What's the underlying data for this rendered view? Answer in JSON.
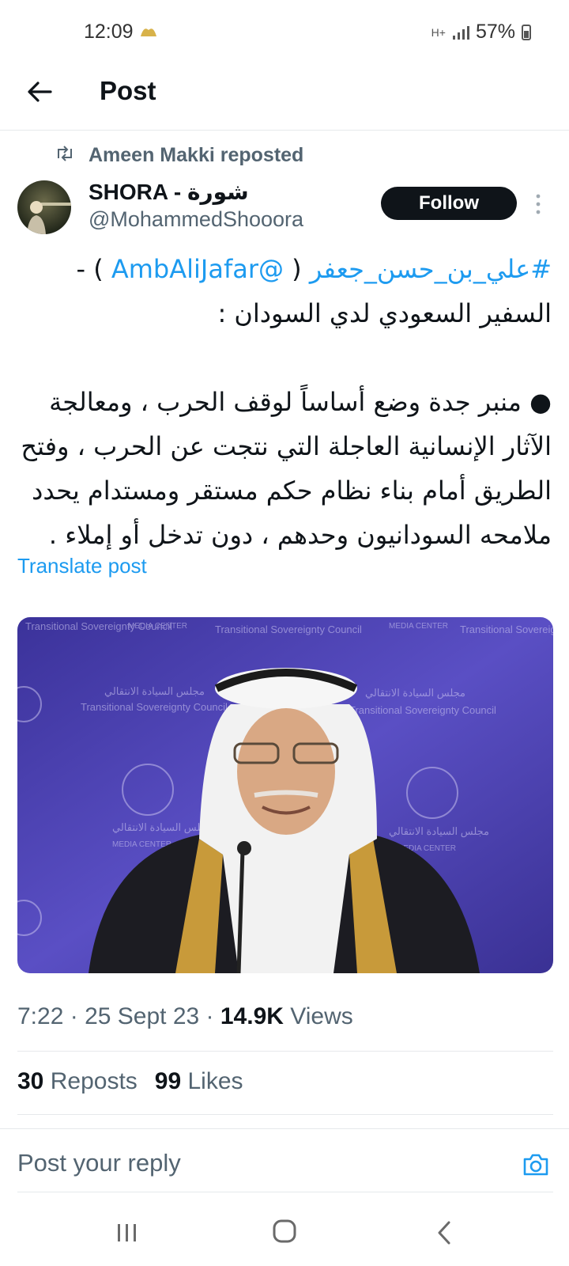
{
  "status_bar": {
    "time": "12:09",
    "battery": "57%",
    "network": "H+"
  },
  "header": {
    "title": "Post"
  },
  "repost": {
    "text": "Ameen Makki reposted"
  },
  "author": {
    "name": "SHORA - شورة",
    "handle": "@MohammedShooora"
  },
  "follow_label": "Follow",
  "tweet": {
    "hashtag": "#علي_بن_حسن_جعفر",
    "open_paren": " ( ",
    "mention": "@AmbAliJafar",
    "close": " ) -",
    "line2": "السفير السعودي لدي السودان :",
    "paragraph": "● منبر جدة وضع أساساً لوقف الحرب ، ومعالجة الآثار الإنسانية العاجلة التي نتجت عن الحرب ، وفتح الطريق أمام بناء نظام حكم مستقر ومستدام يحدد ملامحه السودانيون وحدهم ، دون تدخل أو إملاء ."
  },
  "translate_label": "Translate post",
  "media": {
    "backdrop_text_1": "Transitional Sovereignty Council",
    "backdrop_text_2": "MEDIA CENTER",
    "backdrop_arabic": "مجلس السيادة الانتقالي"
  },
  "meta": {
    "time": "7:22",
    "date": "25 Sept 23",
    "views_count": "14.9K",
    "views_label": "Views",
    "sep": " · "
  },
  "stats": {
    "reposts_count": "30",
    "reposts_label": "Reposts",
    "likes_count": "99",
    "likes_label": "Likes"
  },
  "reply": {
    "placeholder": "Post your reply"
  },
  "colors": {
    "link": "#1d9bf0",
    "follow_bg": "#0f1419",
    "secondary_text": "#536471",
    "media_bg": "#4a3fb0"
  }
}
